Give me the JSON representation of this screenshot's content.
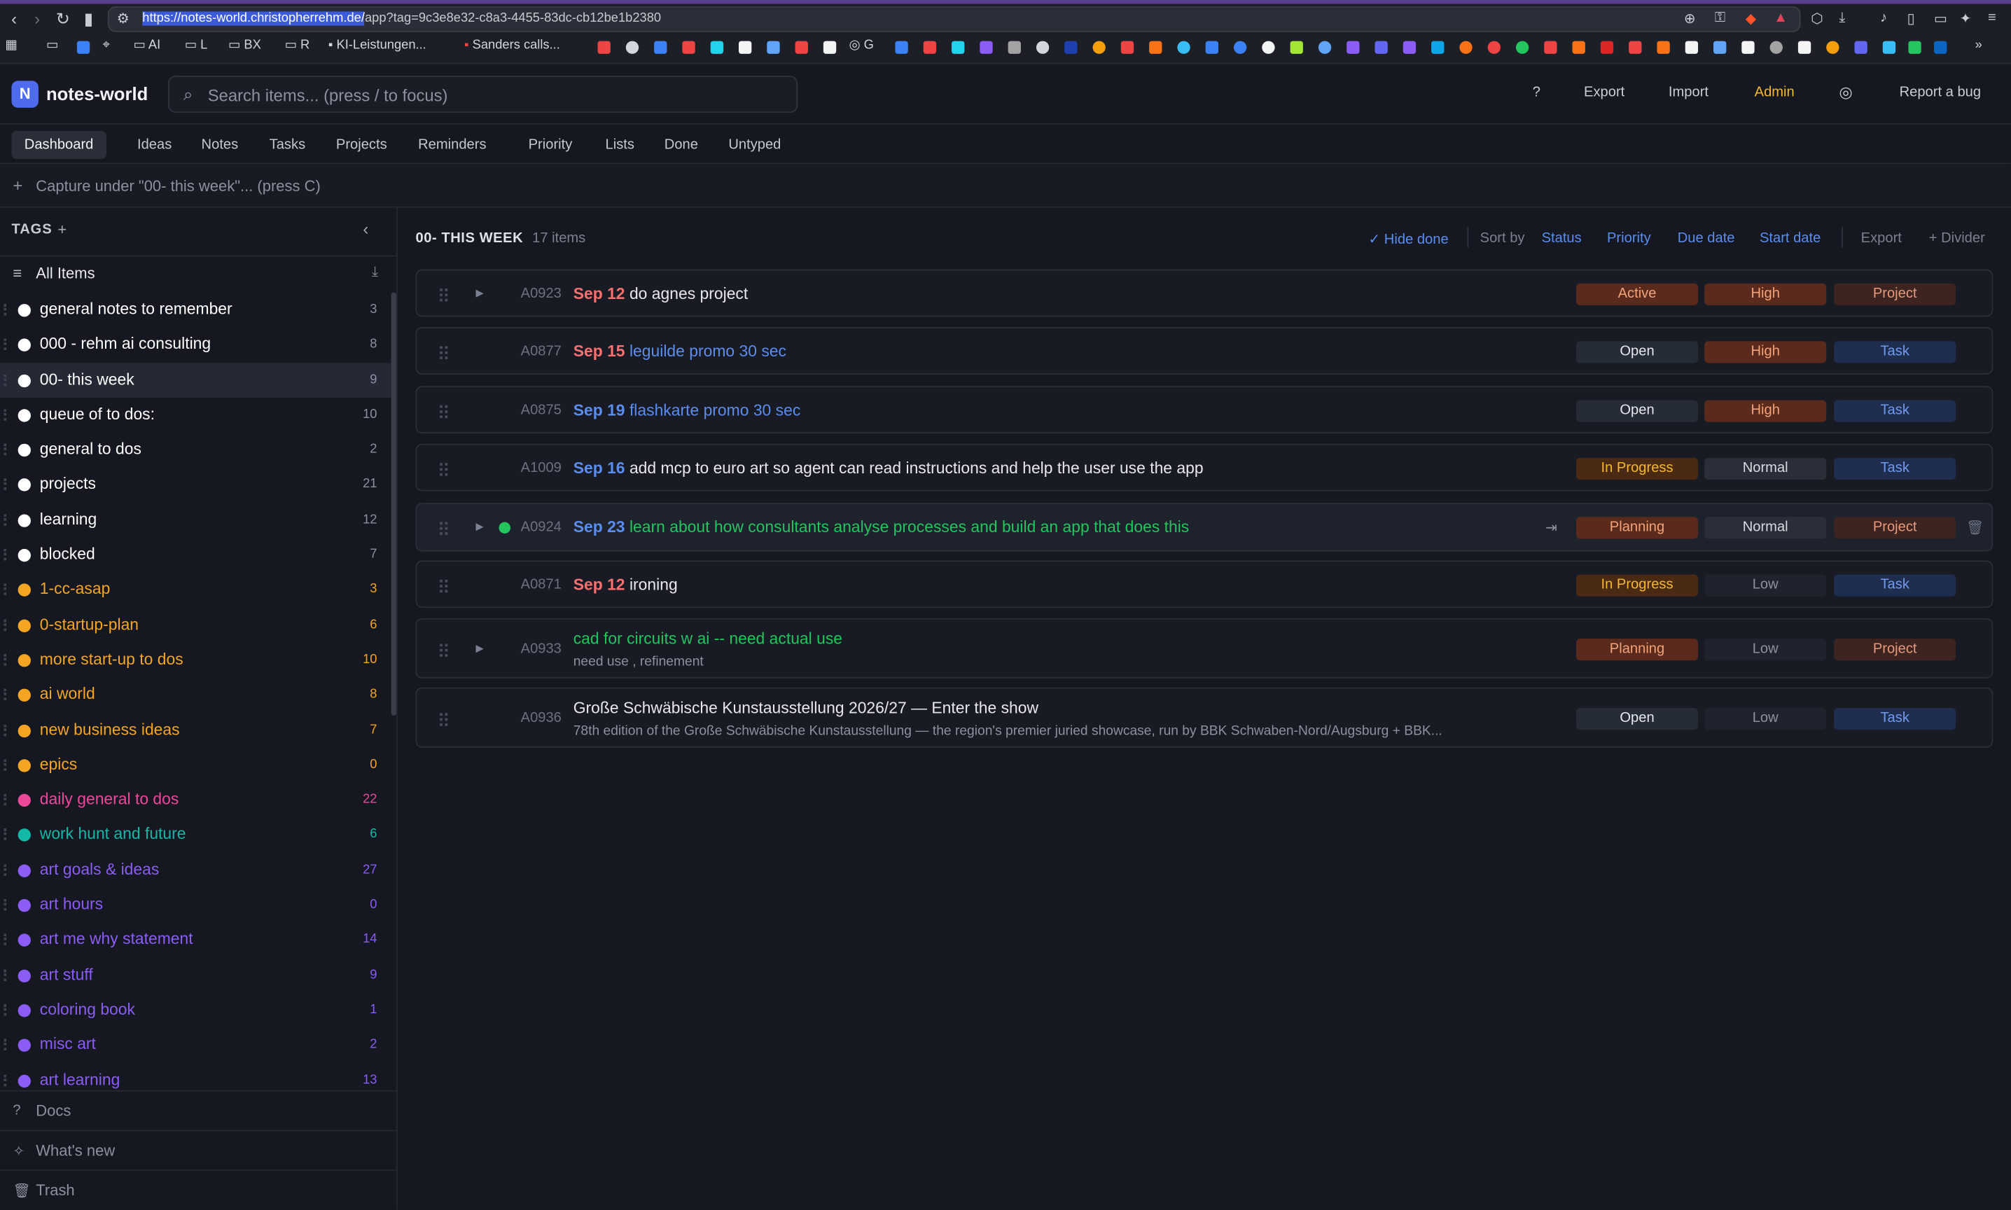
{
  "browser": {
    "url_selected": "https://notes-world.christopherrehm.de/",
    "url_rest": "app?tag=9c3e8e32-c8a3-4455-83dc-cb12be1b2380",
    "bookmarks": [
      "AI",
      "L",
      "BX",
      "R",
      "KI-Leistungen...",
      "Sanders calls...",
      "G"
    ]
  },
  "app": {
    "logo_letter": "N",
    "name": "notes-world",
    "search_placeholder": "Search items... (press / to focus)",
    "header_buttons": {
      "help": "?",
      "export": "Export",
      "import": "Import",
      "admin": "Admin",
      "report": "Report a bug"
    },
    "colors": {
      "accent": "#4f6bed",
      "admin": "#f5b82e"
    }
  },
  "tabs": [
    "Dashboard",
    "Ideas",
    "Notes",
    "Tasks",
    "Projects",
    "Reminders",
    "Priority",
    "Lists",
    "Done",
    "Untyped"
  ],
  "active_tab": "Dashboard",
  "capture_placeholder": "Capture under \"00- this week\"... (press C)",
  "sidebar": {
    "heading": "TAGS",
    "add": "+",
    "all_items": "All Items",
    "tags": [
      {
        "name": "general notes to remember",
        "count": "3",
        "color": "#ffffff"
      },
      {
        "name": "000 - rehm ai consulting",
        "count": "8",
        "color": "#ffffff"
      },
      {
        "name": "00- this week",
        "count": "9",
        "color": "#ffffff",
        "selected": true
      },
      {
        "name": "queue of to dos:",
        "count": "10",
        "color": "#ffffff"
      },
      {
        "name": "general to dos",
        "count": "2",
        "color": "#ffffff"
      },
      {
        "name": "projects",
        "count": "21",
        "color": "#ffffff"
      },
      {
        "name": "learning",
        "count": "12",
        "color": "#ffffff"
      },
      {
        "name": "blocked",
        "count": "7",
        "color": "#ffffff"
      },
      {
        "name": "1-cc-asap",
        "count": "3",
        "color": "#f5a524"
      },
      {
        "name": "0-startup-plan",
        "count": "6",
        "color": "#f5a524"
      },
      {
        "name": "more start-up to dos",
        "count": "10",
        "color": "#f5a524"
      },
      {
        "name": "ai world",
        "count": "8",
        "color": "#f5a524"
      },
      {
        "name": "new business ideas",
        "count": "7",
        "color": "#f5a524"
      },
      {
        "name": "epics",
        "count": "0",
        "color": "#f5a524"
      },
      {
        "name": "daily general to dos",
        "count": "22",
        "color": "#ec4899"
      },
      {
        "name": "work hunt and future",
        "count": "6",
        "color": "#14b8a6"
      },
      {
        "name": "art goals & ideas",
        "count": "27",
        "color": "#8b5cf6"
      },
      {
        "name": "art hours",
        "count": "0",
        "color": "#8b5cf6"
      },
      {
        "name": "art me why statement",
        "count": "14",
        "color": "#8b5cf6"
      },
      {
        "name": "art stuff",
        "count": "9",
        "color": "#8b5cf6"
      },
      {
        "name": "coloring book",
        "count": "1",
        "color": "#8b5cf6"
      },
      {
        "name": "misc art",
        "count": "2",
        "color": "#8b5cf6"
      },
      {
        "name": "art learning",
        "count": "13",
        "color": "#8b5cf6"
      }
    ],
    "footer": {
      "docs": "Docs",
      "whats_new": "What's new",
      "trash": "Trash"
    }
  },
  "main": {
    "title": "00- THIS WEEK",
    "count": "17 items",
    "toolbar": {
      "hide_done": "✓ Hide done",
      "sort_by": "Sort by",
      "status": "Status",
      "priority": "Priority",
      "due_date": "Due date",
      "start_date": "Start date",
      "export": "Export",
      "divider": "+ Divider"
    },
    "items": [
      {
        "code": "A0923",
        "date": "Sep 12",
        "date_color": "red",
        "title": "do agnes project",
        "title_color": "white",
        "expandable": true,
        "status": "Active",
        "priority": "High",
        "type": "Project"
      },
      {
        "code": "A0877",
        "date": "Sep 15",
        "date_color": "red",
        "title": "leguilde promo 30 sec",
        "title_color": "blue",
        "expandable": false,
        "status": "Open",
        "priority": "High",
        "type": "Task"
      },
      {
        "code": "A0875",
        "date": "Sep 19",
        "date_color": "blue",
        "title": "flashkarte promo 30 sec",
        "title_color": "blue",
        "expandable": false,
        "status": "Open",
        "priority": "High",
        "type": "Task"
      },
      {
        "code": "A1009",
        "date": "Sep 16",
        "date_color": "blue",
        "title": "add mcp to euro art so agent can read instructions and help the user use the app",
        "title_color": "white",
        "expandable": false,
        "status": "In Progress",
        "priority": "Normal",
        "type": "Task"
      },
      {
        "code": "A0924",
        "date": "Sep 23",
        "date_color": "blue",
        "title": "learn about how consultants analyse processes and build an app that does this",
        "title_color": "green",
        "expandable": true,
        "dot": true,
        "hover": true,
        "status": "Planning",
        "priority": "Normal",
        "type": "Project"
      },
      {
        "code": "A0871",
        "date": "Sep 12",
        "date_color": "red",
        "title": "ironing",
        "title_color": "white",
        "expandable": false,
        "status": "In Progress",
        "priority": "Low",
        "type": "Task"
      },
      {
        "code": "A0933",
        "date": "",
        "date_color": "",
        "title": "cad for circuits w ai -- need actual use",
        "title_color": "green",
        "subtitle": "need use , refinement",
        "expandable": true,
        "status": "Planning",
        "priority": "Low",
        "type": "Project"
      },
      {
        "code": "A0936",
        "date": "",
        "date_color": "",
        "title": "Große Schwäbische Kunstausstellung 2026/27 — Enter the show",
        "title_color": "white",
        "subtitle": "78th edition of the Große Schwäbische Kunstausstellung — the region's premier juried showcase, run by BBK Schwaben-Nord/Augsburg + BBK...",
        "expandable": false,
        "status": "Open",
        "priority": "Low",
        "type": "Task"
      }
    ]
  },
  "pill_styles": {
    "Active": {
      "bg": "#5a2a1c",
      "fg": "#f3a37a"
    },
    "Open": {
      "bg": "#262b38",
      "fg": "#e6e8ee"
    },
    "In Progress": {
      "bg": "#4a2a12",
      "fg": "#f5b82e"
    },
    "Planning": {
      "bg": "#5a2a1c",
      "fg": "#f3a37a"
    },
    "High": {
      "bg": "#5a2a1c",
      "fg": "#f3a37a"
    },
    "Normal": {
      "bg": "#2a2e39",
      "fg": "#d8dbe3"
    },
    "Low": {
      "bg": "#1f232d",
      "fg": "#8c91a0"
    },
    "Project": {
      "bg": "#3e2420",
      "fg": "#e59a7c"
    },
    "Task": {
      "bg": "#1f2d4e",
      "fg": "#6f9bf2"
    }
  }
}
